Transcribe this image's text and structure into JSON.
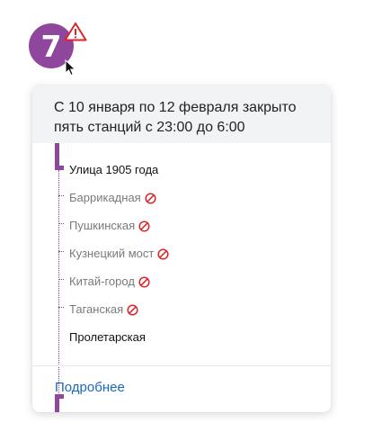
{
  "line": {
    "number": "7",
    "color": "#8e479c",
    "badge_icon": "metro-line-7-badge",
    "alert_icon": "warning-triangle-icon",
    "alert_color": "#d9252a"
  },
  "notice": {
    "line1": "С 10 января по 12 февраля закрыто",
    "line2": "пять станций с 23:00 до 6:00"
  },
  "stations": [
    {
      "name": "Улица 1905 года",
      "closed": false
    },
    {
      "name": "Баррикадная",
      "closed": true
    },
    {
      "name": "Пушкинская",
      "closed": true
    },
    {
      "name": "Кузнецкий мост",
      "closed": true
    },
    {
      "name": "Китай-город",
      "closed": true
    },
    {
      "name": "Таганская",
      "closed": true
    },
    {
      "name": "Пролетарская",
      "closed": false
    }
  ],
  "closed_icon": "no-entry-icon",
  "more_link": "Подробнее"
}
